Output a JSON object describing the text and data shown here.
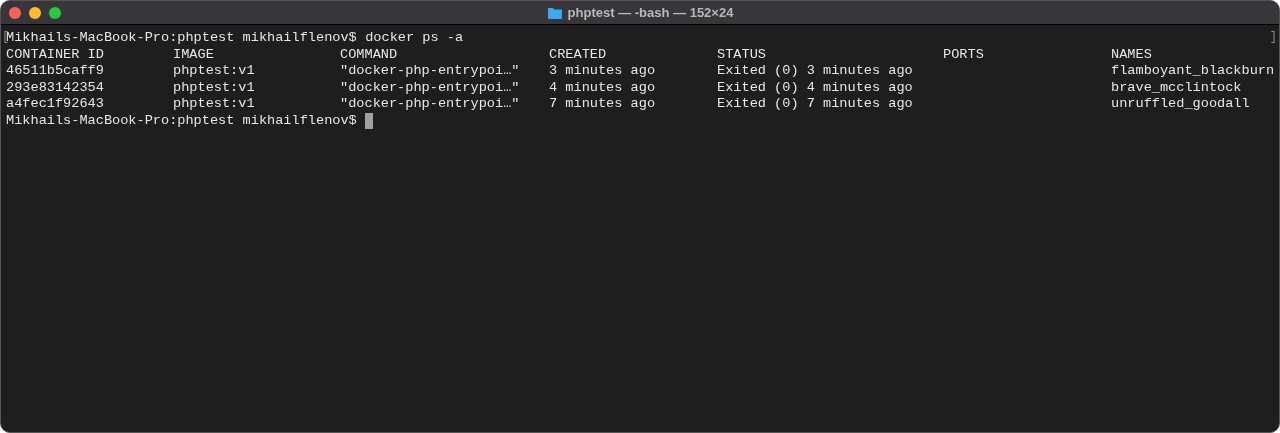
{
  "window": {
    "title": "phptest — -bash — 152×24"
  },
  "terminal": {
    "mark_left": "[",
    "mark_right": "]",
    "command_prompt": {
      "prompt": "Mikhails-MacBook-Pro:phptest mikhailflenov$",
      "command": "docker ps -a"
    },
    "table": {
      "columns": [
        "CONTAINER ID",
        "IMAGE",
        "COMMAND",
        "CREATED",
        "STATUS",
        "PORTS",
        "NAMES"
      ],
      "rows": [
        [
          "46511b5caff9",
          "phptest:v1",
          "\"docker-php-entrypoi…\"",
          "3 minutes ago",
          "Exited (0) 3 minutes ago",
          "",
          "flamboyant_blackburn"
        ],
        [
          "293e83142354",
          "phptest:v1",
          "\"docker-php-entrypoi…\"",
          "4 minutes ago",
          "Exited (0) 4 minutes ago",
          "",
          "brave_mcclintock"
        ],
        [
          "a4fec1f92643",
          "phptest:v1",
          "\"docker-php-entrypoi…\"",
          "7 minutes ago",
          "Exited (0) 7 minutes ago",
          "",
          "unruffled_goodall"
        ]
      ]
    },
    "final_prompt": {
      "prompt": "Mikhails-MacBook-Pro:phptest mikhailflenov$",
      "cursor": true
    }
  }
}
